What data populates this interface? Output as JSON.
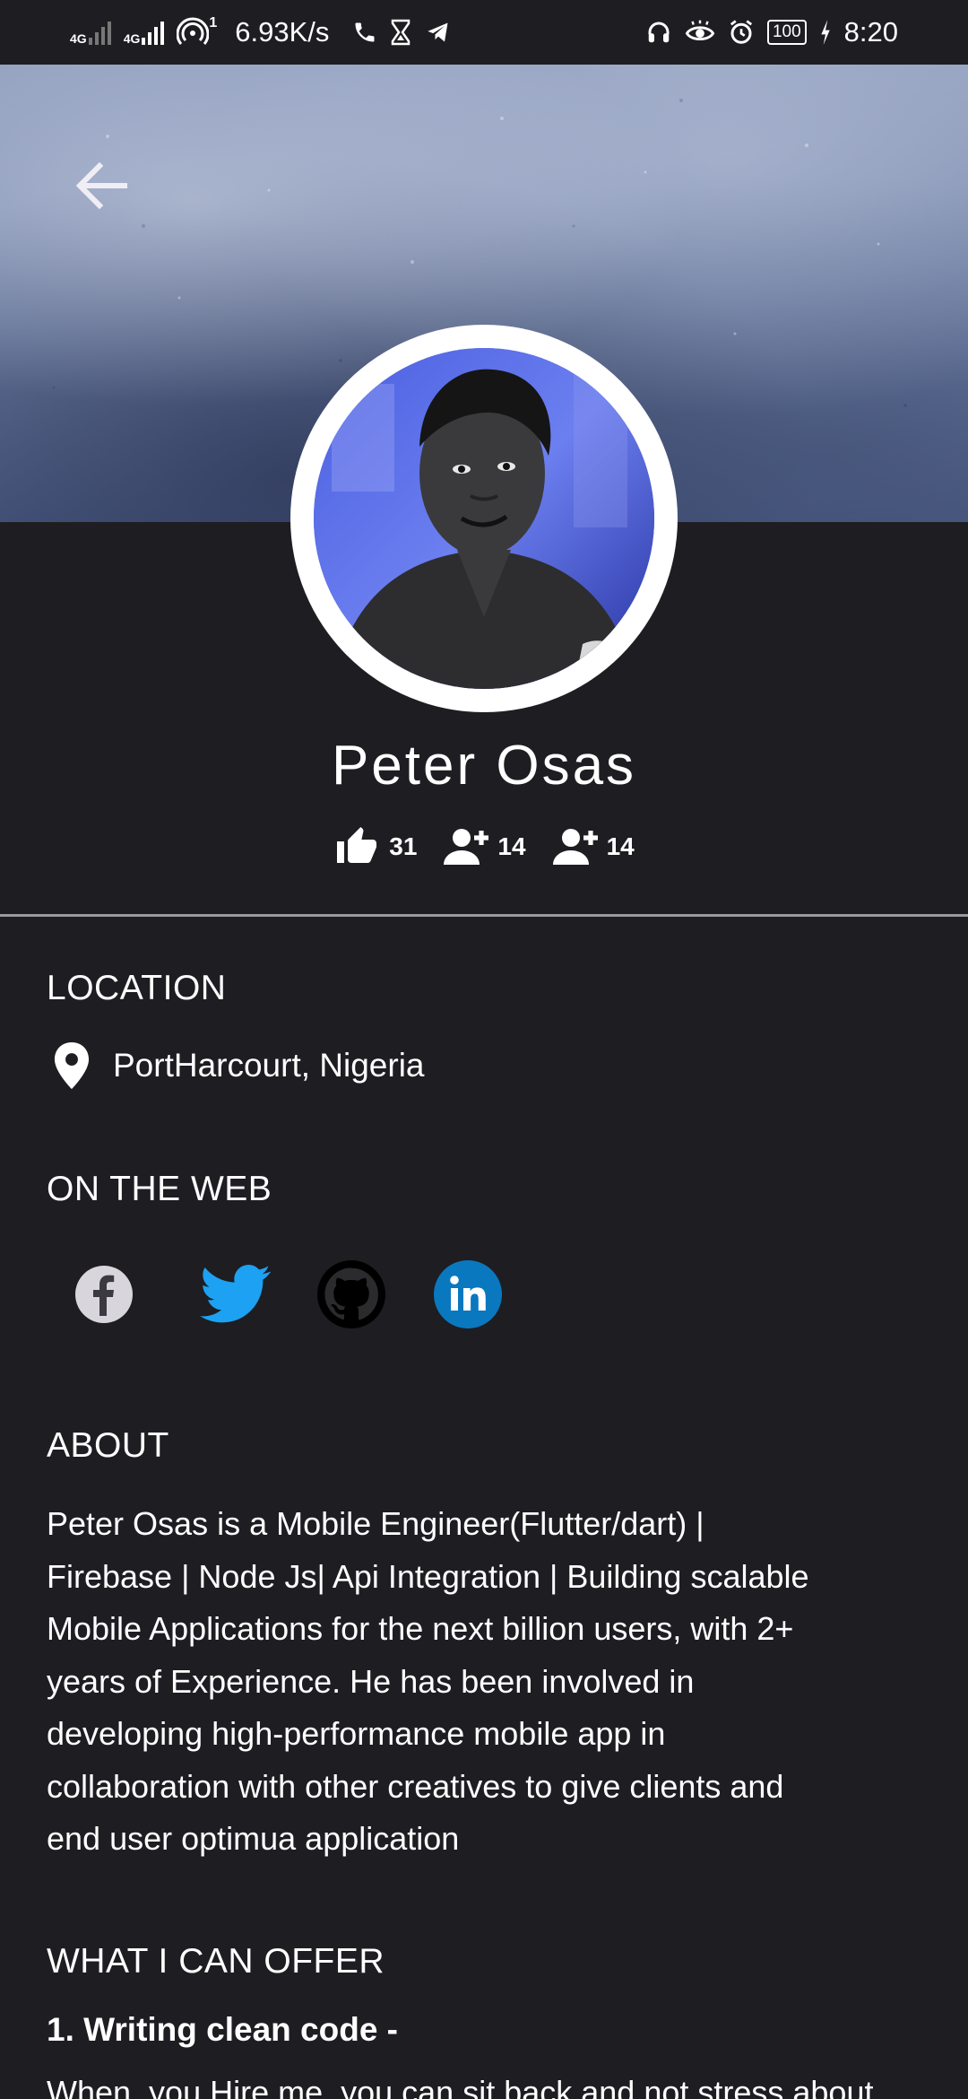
{
  "status_bar": {
    "net1": "4G",
    "net2": "4G",
    "hotspot_count": "1",
    "speed": "6.93K/s",
    "battery": "100",
    "time": "8:20"
  },
  "profile": {
    "name": "Peter Osas",
    "likes": "31",
    "followers": "14",
    "following": "14"
  },
  "location": {
    "title": "LOCATION",
    "value": "PortHarcourt, Nigeria"
  },
  "web": {
    "title": "ON THE WEB",
    "links": [
      {
        "name": "facebook",
        "color": "#3b5998"
      },
      {
        "name": "twitter",
        "color": "#1da1f2"
      },
      {
        "name": "github",
        "color": "#000000"
      },
      {
        "name": "linkedin",
        "color": "#0a78be"
      }
    ]
  },
  "about": {
    "title": "ABOUT",
    "lines": [
      "Peter Osas is a Mobile Engineer(Flutter/dart) |",
      "Firebase | Node Js| Api Integration | Building scalable",
      "Mobile Applications for the next billion users, with 2+",
      "years of Experience. He has been involved in",
      "developing high-performance mobile app in",
      "collaboration with other creatives to give clients and",
      "end user optimua application"
    ]
  },
  "offer": {
    "title": "WHAT I CAN OFFER",
    "item1": "1. Writing clean code -",
    "item1_desc": "When, you Hire me, you can sit back and not stress about"
  },
  "colors": {
    "background": "#1e1d21",
    "twitter": "#1da1f2",
    "linkedin": "#0a78be"
  }
}
